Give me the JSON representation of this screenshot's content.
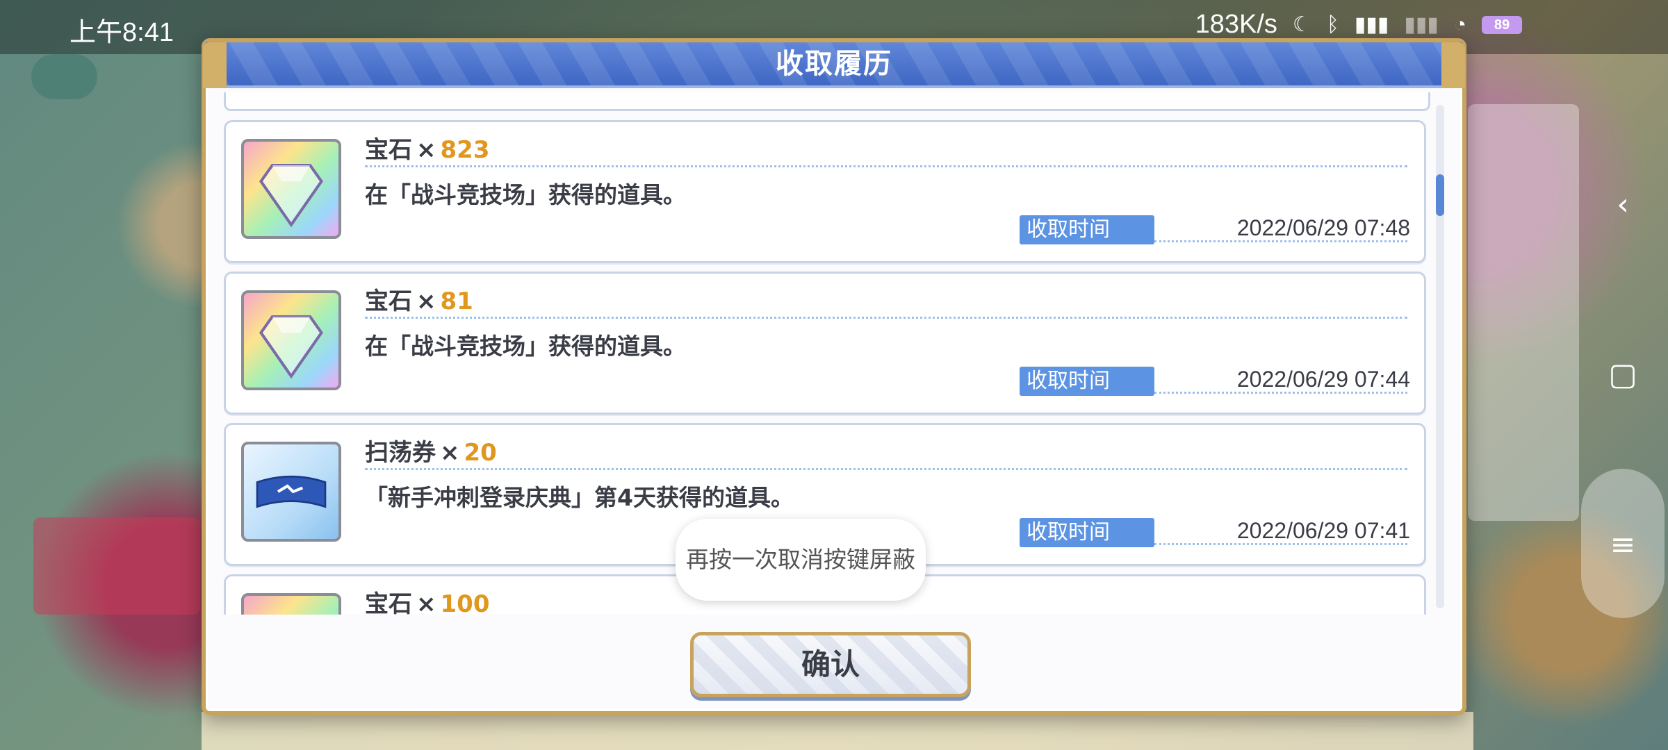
{
  "status_bar": {
    "time": "上午8:41",
    "net_speed": "183K/s",
    "battery": "89"
  },
  "dialog": {
    "title": "收取履历",
    "confirm_label": "确认",
    "toast": "再按一次取消按键屏蔽",
    "time_label": "收取时间",
    "items": [
      {
        "icon": "gem-icon",
        "name": "宝石",
        "mult": "×",
        "qty": "823",
        "desc": "在「战斗竞技场」获得的道具。",
        "time": "2022/06/29  07:48"
      },
      {
        "icon": "gem-icon",
        "name": "宝石",
        "mult": "×",
        "qty": "81",
        "desc": "在「战斗竞技场」获得的道具。",
        "time": "2022/06/29  07:44"
      },
      {
        "icon": "sweep-ticket-icon",
        "name": "扫荡券",
        "mult": "×",
        "qty": "20",
        "desc": "「新手冲刺登录庆典」第4天获得的道具。",
        "time": "2022/06/29  07:41"
      },
      {
        "icon": "gem-icon",
        "name": "宝石",
        "mult": "×",
        "qty": "100",
        "desc": "",
        "time": ""
      }
    ]
  },
  "colors": {
    "header_blue": "#4a72cc",
    "accent_gold": "#c7a35e",
    "qty_orange": "#e1961c",
    "badge_blue": "#5c93e2"
  }
}
